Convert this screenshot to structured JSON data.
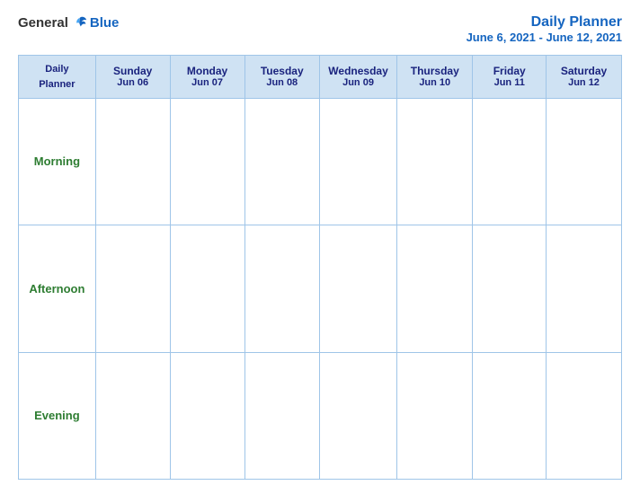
{
  "header": {
    "logo": {
      "general": "General",
      "blue": "Blue"
    },
    "title": "Daily Planner",
    "subtitle": "June 6, 2021 - June 12, 2021"
  },
  "table": {
    "header_label": "Daily\nPlanner",
    "days": [
      {
        "name": "Sunday",
        "date": "Jun 06"
      },
      {
        "name": "Monday",
        "date": "Jun 07"
      },
      {
        "name": "Tuesday",
        "date": "Jun 08"
      },
      {
        "name": "Wednesday",
        "date": "Jun 09"
      },
      {
        "name": "Thursday",
        "date": "Jun 10"
      },
      {
        "name": "Friday",
        "date": "Jun 11"
      },
      {
        "name": "Saturday",
        "date": "Jun 12"
      }
    ],
    "rows": [
      {
        "label": "Morning"
      },
      {
        "label": "Afternoon"
      },
      {
        "label": "Evening"
      }
    ]
  }
}
